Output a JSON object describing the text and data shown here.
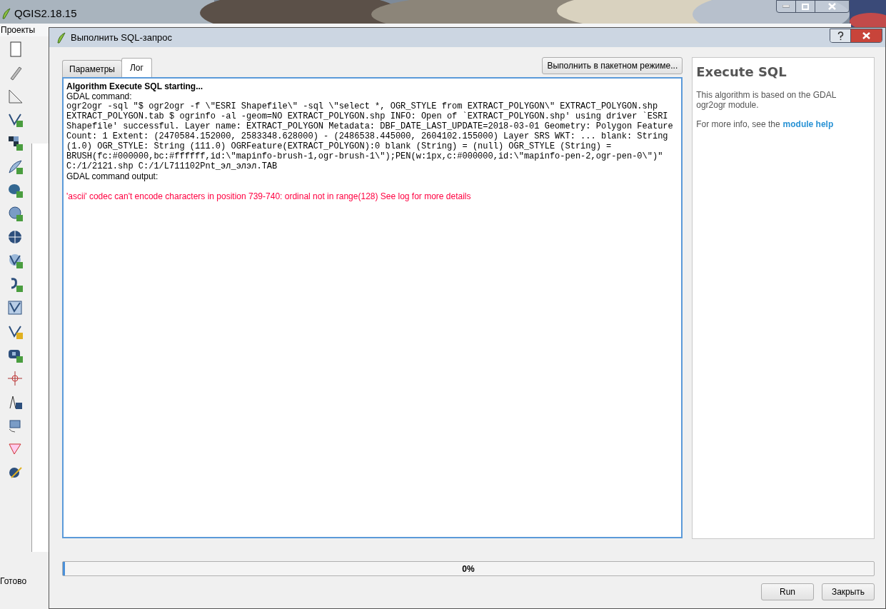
{
  "qgis_window": {
    "title": "QGIS2.18.15",
    "menu": [
      "Проекты"
    ],
    "status": "Готово"
  },
  "dialog": {
    "title": "Выполнить SQL-запрос",
    "tabs": [
      {
        "label": "Параметры",
        "selected": false
      },
      {
        "label": "Лог",
        "selected": true
      }
    ],
    "batch_button": "Выполнить в пакетном режиме...",
    "log": [
      {
        "kind": "heading",
        "text": "Algorithm Execute SQL starting..."
      },
      {
        "kind": "plain",
        "text": "GDAL command:"
      },
      {
        "kind": "code",
        "text": "ogr2ogr -sql \"$ ogr2ogr -f \\\"ESRI Shapefile\\\" -sql \\\"select *, OGR_STYLE from EXTRACT_POLYGON\\\" EXTRACT_POLYGON.shp"
      },
      {
        "kind": "code",
        "text": "EXTRACT_POLYGON.tab $ ogrinfo -al -geom=NO EXTRACT_POLYGON.shp INFO: Open of `EXTRACT_POLYGON.shp' using driver `ESRI"
      },
      {
        "kind": "code",
        "text": "Shapefile' successful. Layer name: EXTRACT_POLYGON Metadata: DBF_DATE_LAST_UPDATE=2018-03-01 Geometry: Polygon Feature"
      },
      {
        "kind": "code",
        "text": "Count: 1 Extent: (2470584.152000, 2583348.628000) - (2486538.445000, 2604102.155000) Layer SRS WKT: ... blank: String"
      },
      {
        "kind": "code",
        "text": "(1.0) OGR_STYLE: String (111.0) OGRFeature(EXTRACT_POLYGON):0 blank (String) = (null) OGR_STYLE (String) ="
      },
      {
        "kind": "code",
        "text": "BRUSH(fc:#000000,bc:#ffffff,id:\\\"mapinfo-brush-1,ogr-brush-1\\\");PEN(w:1px,c:#000000,id:\\\"mapinfo-pen-2,ogr-pen-0\\\")\""
      },
      {
        "kind": "code",
        "text": "C:/1/2121.shp C:/1/L711102Pnt_эл_элэл.TAB"
      },
      {
        "kind": "plain",
        "text": "GDAL command output:"
      },
      {
        "kind": "error",
        "text": "'ascii' codec can't encode characters in position 739-740: ordinal not in range(128) See log for more details"
      }
    ],
    "help": {
      "title": "Execute SQL",
      "description": "This algorithm is based on the GDAL ogr2ogr module.",
      "more_info": "For more info, see the",
      "link": "module help"
    },
    "progress": {
      "level": 0,
      "text": "0%"
    },
    "buttons": [
      "Run",
      "Закрыть"
    ]
  }
}
